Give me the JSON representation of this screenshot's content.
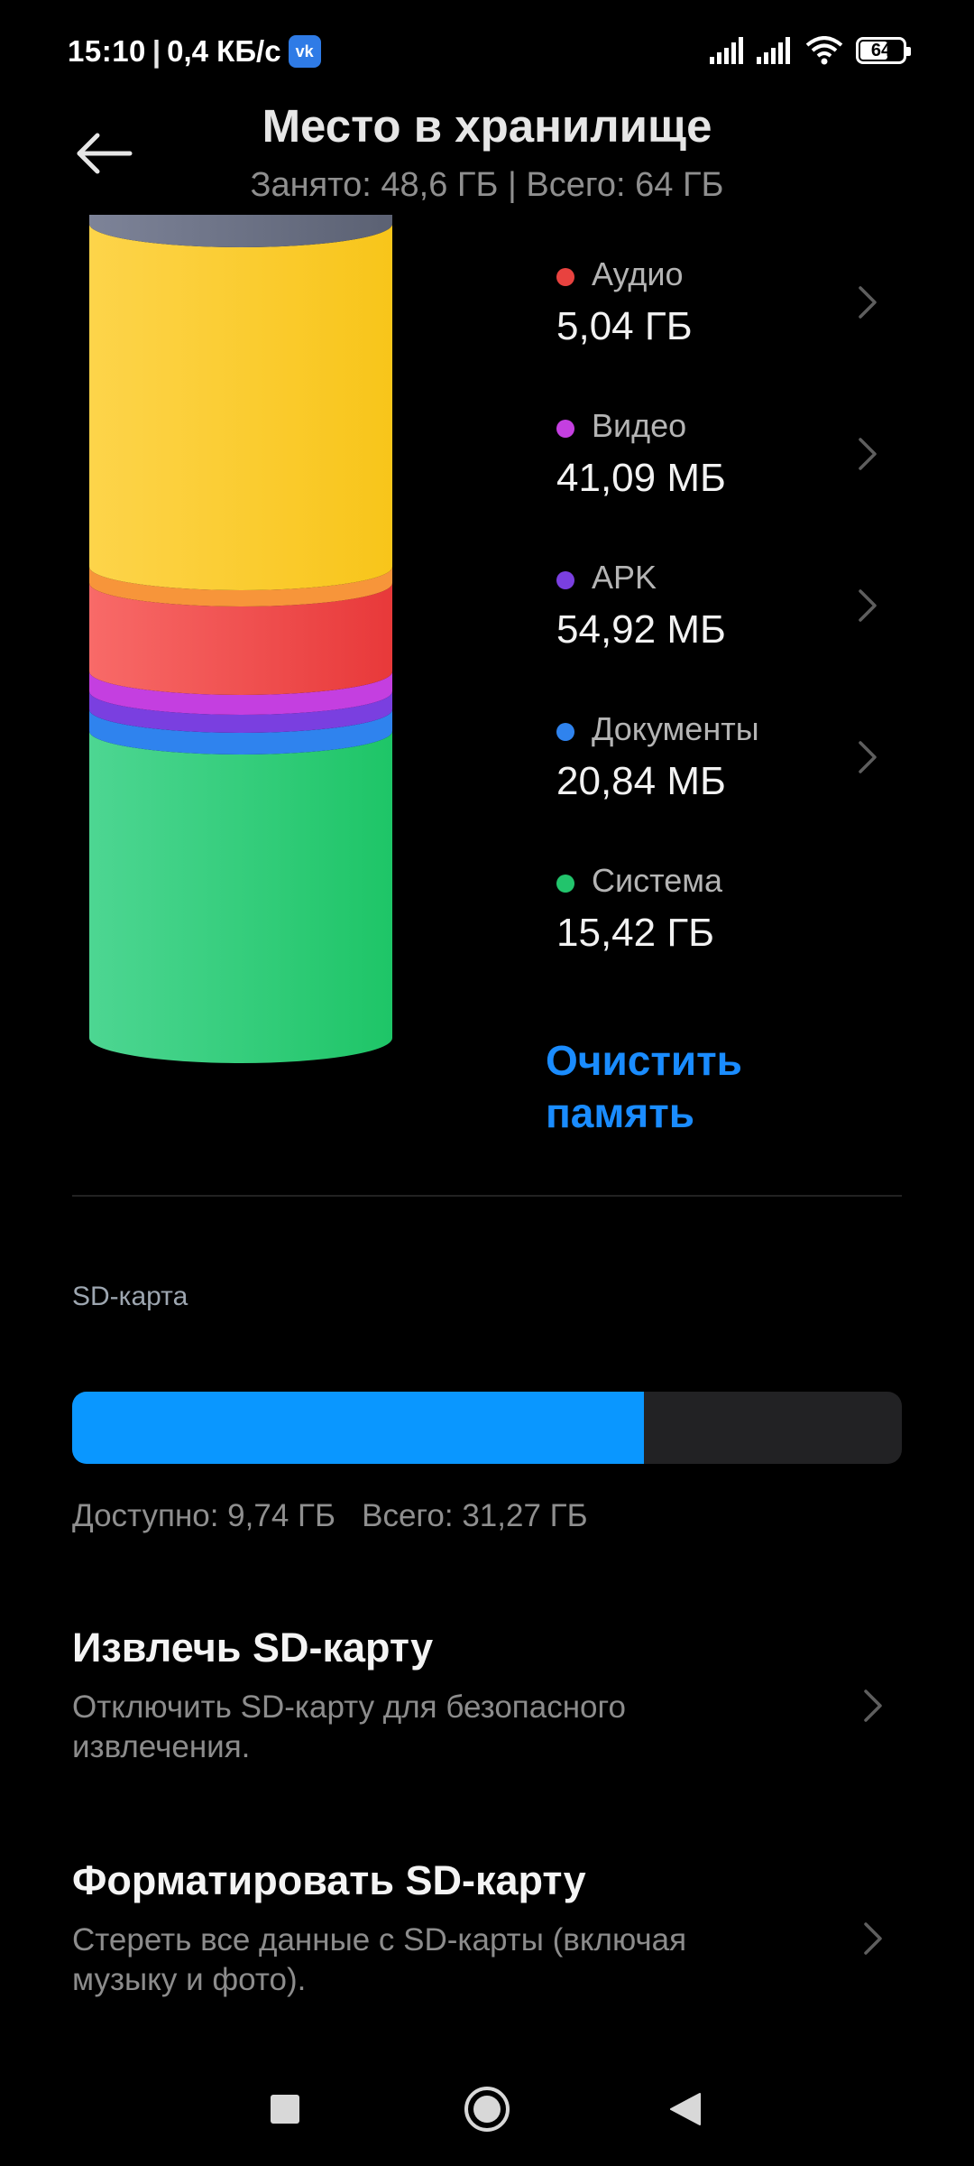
{
  "status_bar": {
    "time": "15:10",
    "separator": "|",
    "speed": "0,4 КБ/с",
    "vk_icon_text": "vk",
    "battery": "64"
  },
  "header": {
    "title": "Место в хранилище",
    "subtitle": "Занято: 48,6 ГБ | Всего: 64 ГБ"
  },
  "storage": {
    "categories": [
      {
        "name": "Аудио",
        "size": "5,04 ГБ",
        "color": "#e8423f",
        "chevron": true
      },
      {
        "name": "Видео",
        "size": "41,09 МБ",
        "color": "#c43fe0",
        "chevron": true
      },
      {
        "name": "APK",
        "size": "54,92 МБ",
        "color": "#7a3fe0",
        "chevron": true
      },
      {
        "name": "Документы",
        "size": "20,84 МБ",
        "color": "#2f83ee",
        "chevron": true
      },
      {
        "name": "Система",
        "size": "15,42 ГБ",
        "color": "#22c46c",
        "chevron": false
      }
    ],
    "clean_button": "Очистить память"
  },
  "sd_card": {
    "label": "SD-карта",
    "used_fraction": 0.689,
    "bar_color": "#0a97ff",
    "stats": "Доступно: 9,74 ГБ   Всего: 31,27 ГБ"
  },
  "actions": [
    {
      "title": "Извлечь SD-карту",
      "description": "Отключить SD-карту для безопасного извлечения."
    },
    {
      "title": "Форматировать SD-карту",
      "description": "Стереть все данные с SD-карты (включая музыку и фото)."
    }
  ],
  "nav": {
    "recents_icon": "square-icon",
    "home_icon": "circle-icon",
    "back_icon": "triangle-back-icon"
  }
}
